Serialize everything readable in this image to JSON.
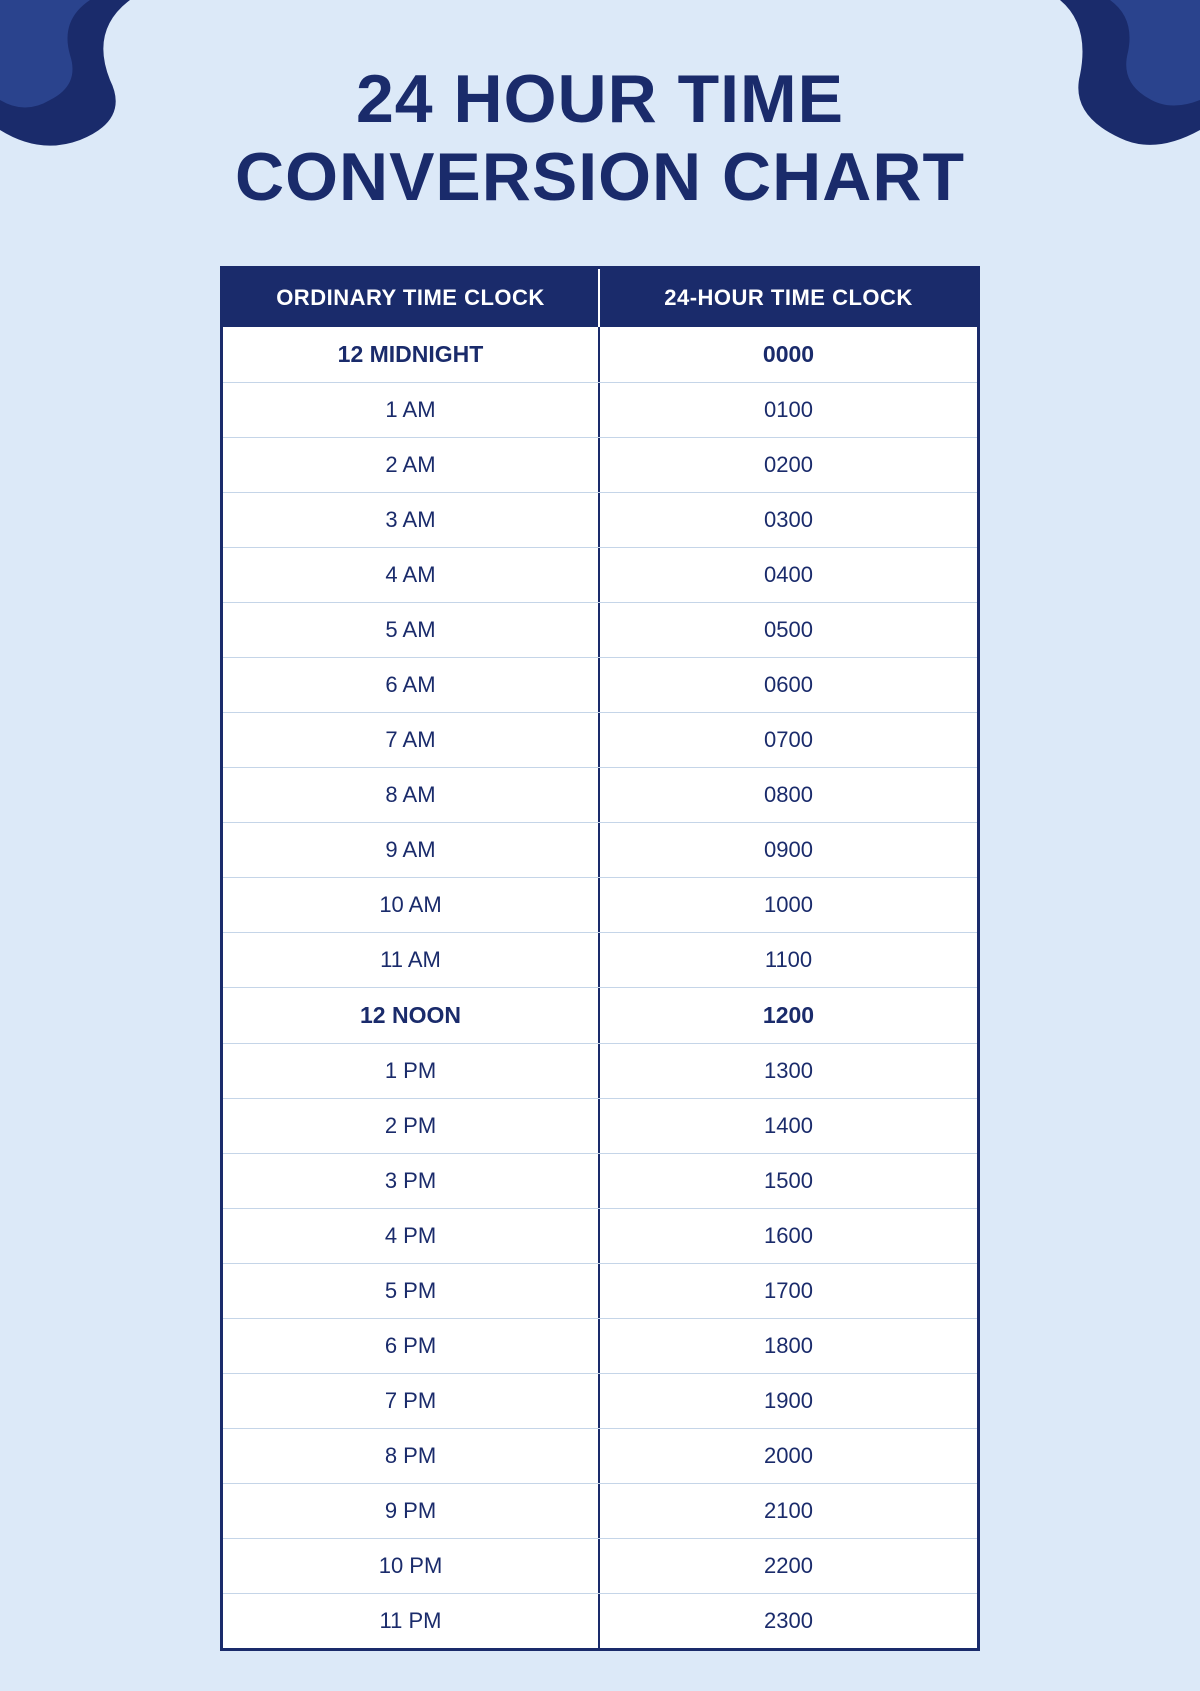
{
  "page": {
    "background_color": "#dce9f8",
    "title_line1": "24 HOUR TIME",
    "title_line2": "CONVERSION CHART"
  },
  "table": {
    "header": {
      "col1": "ORDINARY TIME CLOCK",
      "col2": "24-HOUR TIME CLOCK"
    },
    "rows": [
      {
        "ordinary": "12 MIDNIGHT",
        "military": "0000",
        "bold": true
      },
      {
        "ordinary": "1 AM",
        "military": "0100",
        "bold": false
      },
      {
        "ordinary": "2 AM",
        "military": "0200",
        "bold": false
      },
      {
        "ordinary": "3 AM",
        "military": "0300",
        "bold": false
      },
      {
        "ordinary": "4 AM",
        "military": "0400",
        "bold": false
      },
      {
        "ordinary": "5 AM",
        "military": "0500",
        "bold": false
      },
      {
        "ordinary": "6 AM",
        "military": "0600",
        "bold": false
      },
      {
        "ordinary": "7 AM",
        "military": "0700",
        "bold": false
      },
      {
        "ordinary": "8 AM",
        "military": "0800",
        "bold": false
      },
      {
        "ordinary": "9 AM",
        "military": "0900",
        "bold": false
      },
      {
        "ordinary": "10 AM",
        "military": "1000",
        "bold": false
      },
      {
        "ordinary": "11 AM",
        "military": "1100",
        "bold": false
      },
      {
        "ordinary": "12 NOON",
        "military": "1200",
        "bold": true
      },
      {
        "ordinary": "1 PM",
        "military": "1300",
        "bold": false
      },
      {
        "ordinary": "2 PM",
        "military": "1400",
        "bold": false
      },
      {
        "ordinary": "3 PM",
        "military": "1500",
        "bold": false
      },
      {
        "ordinary": "4 PM",
        "military": "1600",
        "bold": false
      },
      {
        "ordinary": "5 PM",
        "military": "1700",
        "bold": false
      },
      {
        "ordinary": "6 PM",
        "military": "1800",
        "bold": false
      },
      {
        "ordinary": "7 PM",
        "military": "1900",
        "bold": false
      },
      {
        "ordinary": "8 PM",
        "military": "2000",
        "bold": false
      },
      {
        "ordinary": "9 PM",
        "military": "2100",
        "bold": false
      },
      {
        "ordinary": "10 PM",
        "military": "2200",
        "bold": false
      },
      {
        "ordinary": "11 PM",
        "military": "2300",
        "bold": false
      }
    ]
  }
}
